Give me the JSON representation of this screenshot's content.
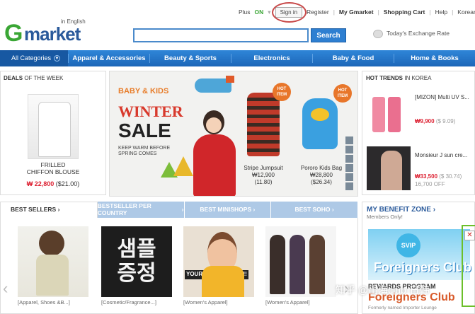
{
  "logo": {
    "g": "G",
    "rest": "market",
    "sub": "in English"
  },
  "topnav": {
    "plus": "Plus",
    "plus_state": "ON",
    "signin": "Sign in",
    "register": "Register",
    "my_gmarket": "My Gmarket",
    "cart": "Shopping Cart",
    "help": "Help",
    "korean": "Korean"
  },
  "search": {
    "value": "",
    "button": "Search"
  },
  "exchange": "Today's Exchange Rate",
  "categories": {
    "all": "All Categories",
    "items": [
      "Apparel & Accessories",
      "Beauty & Sports",
      "Electronics",
      "Baby & Food",
      "Home & Books"
    ]
  },
  "deals": {
    "title_bold": "DEALS",
    "title_rest": "OF THE WEEK",
    "name1": "FRILLED",
    "name2": "CHIFFON BLOUSE",
    "price": "₩ 22,800",
    "price_usd": "($21.00)"
  },
  "banner": {
    "baby_kids": "BABY & KIDS",
    "winter": "WINTER",
    "sale": "SALE",
    "keep_warm": "KEEP WARM BEFORE SPRING COMES",
    "hot_item": "HOT ITEM",
    "product1": {
      "name": "Stripe Jumpsuit",
      "price": "₩12,900",
      "usd": "(11.80)"
    },
    "product2": {
      "name": "Pororo Kids Bag",
      "price": "₩28,800",
      "usd": "($26.34)"
    }
  },
  "hot_trends": {
    "title_bold": "HOT TRENDS",
    "title_rest": "IN KOREA",
    "item1": {
      "name": "[MIZON] Multi UV S...",
      "price": "₩9,900",
      "usd": "($ 9.09)"
    },
    "item2": {
      "name": "Monsieur J sun cre...",
      "price": "₩33,500",
      "usd": "($ 30.74)",
      "old": "16,700 OFF"
    }
  },
  "tabs": [
    "BEST SELLERS",
    "BESTSELLER PER COUNTRY",
    "BEST MINISHOPS",
    "BEST SOHO"
  ],
  "products": [
    {
      "caption": "[Apparel, Shoes &B...]"
    },
    {
      "caption": "[Cosmetic/Fragrance...]",
      "text1": "샘플",
      "text2": "증정"
    },
    {
      "caption": "[Women's Apparel]",
      "badge": "YOUR CHECK POINT!!"
    },
    {
      "caption": "[Women's Apparel]"
    }
  ],
  "benefit": {
    "title": "MY BENEFIT ZONE",
    "sub": "Members Only!",
    "svip": "SVIP",
    "foreigners": "Foreigners Club",
    "rewards": "REWARDS PROGRAM",
    "foreigners2": "Foreigners Club",
    "formerly": "Formerly named Importer Lounge"
  },
  "watermark": "知乎 @出海club-日韩"
}
